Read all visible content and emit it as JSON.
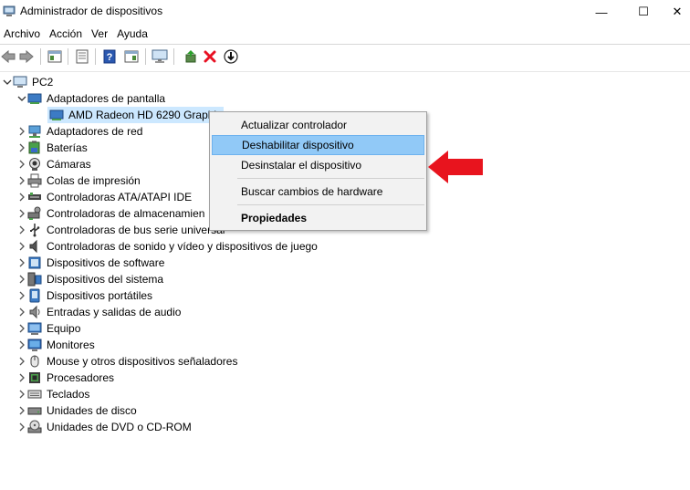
{
  "window": {
    "title": "Administrador de dispositivos",
    "minimize_glyph": "—",
    "maximize_glyph": "☐",
    "close_glyph": "✕"
  },
  "menu": [
    "Archivo",
    "Acción",
    "Ver",
    "Ayuda"
  ],
  "toolbar": {
    "icons": [
      "back-icon",
      "forward-icon",
      "show-hide-console-tree-icon",
      "properties-icon",
      "help-icon",
      "action-pane-icon",
      "monitor-icon",
      "update-driver-icon",
      "uninstall-icon",
      "disable-device-icon"
    ],
    "uninstall_color": "#e81123"
  },
  "tree": {
    "root": "PC2",
    "items": [
      {
        "label": "Adaptadores de pantalla",
        "expanded": true,
        "icon": "display-adapter-icon"
      },
      {
        "label": "AMD Radeon HD 6290 Graphi",
        "child": true,
        "icon": "display-adapter-icon",
        "selected": true
      },
      {
        "label": "Adaptadores de red",
        "icon": "network-adapter-icon"
      },
      {
        "label": "Baterías",
        "icon": "battery-icon"
      },
      {
        "label": "Cámaras",
        "icon": "camera-icon"
      },
      {
        "label": "Colas de impresión",
        "icon": "printer-icon"
      },
      {
        "label": "Controladoras ATA/ATAPI IDE",
        "icon": "ide-controller-icon"
      },
      {
        "label": "Controladoras de almacenamien",
        "icon": "storage-controller-icon"
      },
      {
        "label": "Controladoras de bus serie universal",
        "icon": "usb-controller-icon"
      },
      {
        "label": "Controladoras de sonido y vídeo y dispositivos de juego",
        "icon": "sound-icon"
      },
      {
        "label": "Dispositivos de software",
        "icon": "software-device-icon"
      },
      {
        "label": "Dispositivos del sistema",
        "icon": "system-device-icon"
      },
      {
        "label": "Dispositivos portátiles",
        "icon": "portable-device-icon"
      },
      {
        "label": "Entradas y salidas de audio",
        "icon": "audio-io-icon"
      },
      {
        "label": "Equipo",
        "icon": "computer-icon"
      },
      {
        "label": "Monitores",
        "icon": "monitor-icon"
      },
      {
        "label": "Mouse y otros dispositivos señaladores",
        "icon": "mouse-icon"
      },
      {
        "label": "Procesadores",
        "icon": "processor-icon"
      },
      {
        "label": "Teclados",
        "icon": "keyboard-icon"
      },
      {
        "label": "Unidades de disco",
        "icon": "disk-drive-icon"
      },
      {
        "label": "Unidades de DVD o CD-ROM",
        "icon": "dvd-drive-icon"
      }
    ]
  },
  "context_menu": {
    "items": [
      {
        "label": "Actualizar controlador"
      },
      {
        "label": "Deshabilitar dispositivo",
        "highlighted": true
      },
      {
        "label": "Desinstalar el dispositivo"
      },
      {
        "label": "Buscar cambios de hardware"
      },
      {
        "label": "Propiedades",
        "bold": true
      }
    ],
    "highlight_color": "#91c9f7"
  },
  "annotation": {
    "arrow_color": "#e8141e"
  },
  "colors": {
    "selection": "#cce8ff",
    "chevron": "#555555"
  }
}
